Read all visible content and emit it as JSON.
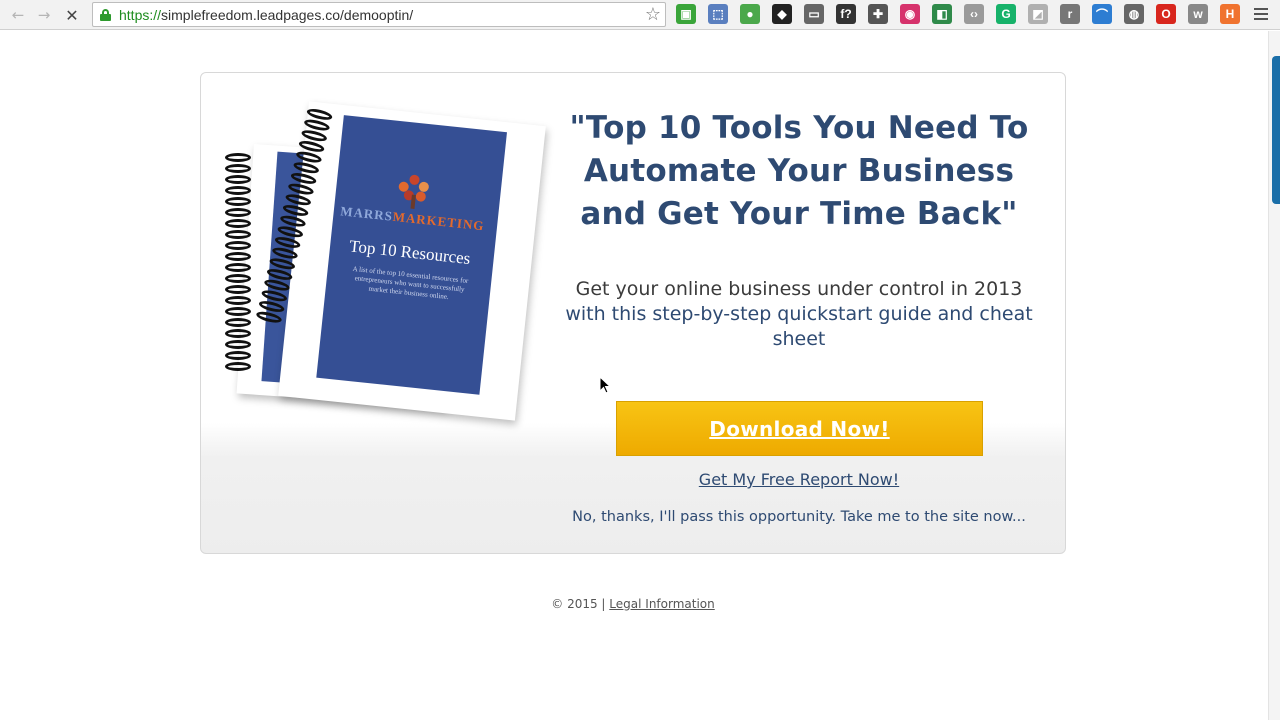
{
  "browser": {
    "url_scheme": "https://",
    "url_rest": "simplefreedom.leadpages.co/demooptin/",
    "extensions": [
      {
        "name": "evernote-icon",
        "color": "#3aa53a",
        "glyph": "▣"
      },
      {
        "name": "screenshot-icon",
        "color": "#5a7fbf",
        "glyph": "⬚"
      },
      {
        "name": "pushbullet-icon",
        "color": "#4ba84b",
        "glyph": "●"
      },
      {
        "name": "hootsuite-icon",
        "color": "#222222",
        "glyph": "◆"
      },
      {
        "name": "cast-icon",
        "color": "#666666",
        "glyph": "▭"
      },
      {
        "name": "whatfont-icon",
        "color": "#333333",
        "glyph": "f?"
      },
      {
        "name": "extension-icon",
        "color": "#555555",
        "glyph": "✚"
      },
      {
        "name": "colorpick-icon",
        "color": "#d6336c",
        "glyph": "◉"
      },
      {
        "name": "extension-green-icon",
        "color": "#2f8a4a",
        "glyph": "◧"
      },
      {
        "name": "code-icon",
        "color": "#9a9a9a",
        "glyph": "‹›"
      },
      {
        "name": "grammarly-icon",
        "color": "#17b26a",
        "glyph": "G"
      },
      {
        "name": "extension-gray-icon",
        "color": "#b0b0b0",
        "glyph": "◩"
      },
      {
        "name": "extension-r-icon",
        "color": "#777777",
        "glyph": "r"
      },
      {
        "name": "rainbow-icon",
        "color": "#2d7dd2",
        "glyph": "⌒"
      },
      {
        "name": "ghostery-icon",
        "color": "#666666",
        "glyph": "◍"
      },
      {
        "name": "opera-icon",
        "color": "#d8261d",
        "glyph": "O"
      },
      {
        "name": "extension-w-icon",
        "color": "#888888",
        "glyph": "w"
      },
      {
        "name": "hubspot-icon",
        "color": "#f0732f",
        "glyph": "H"
      }
    ]
  },
  "page": {
    "cover": {
      "brand_a": "MARRS",
      "brand_b": "MARKETING",
      "title": "Top 10 Resources",
      "desc": "A list of the top 10 essential resources for entrepreneurs who want to successfully market their business online."
    },
    "headline": "\"Top 10 Tools You Need To Automate Your Business and Get Your Time Back\"",
    "sub_plain": "Get your online business under control in 2013",
    "sub_highlight": "with this step-by-step quickstart guide and cheat sheet",
    "download_label": "Download Now!",
    "free_report_label": "Get My Free Report Now!",
    "no_thanks_label": "No, thanks, I'll pass this opportunity. Take me to the site now...",
    "footer_copy": "© 2015 |",
    "footer_link": "Legal Information"
  }
}
